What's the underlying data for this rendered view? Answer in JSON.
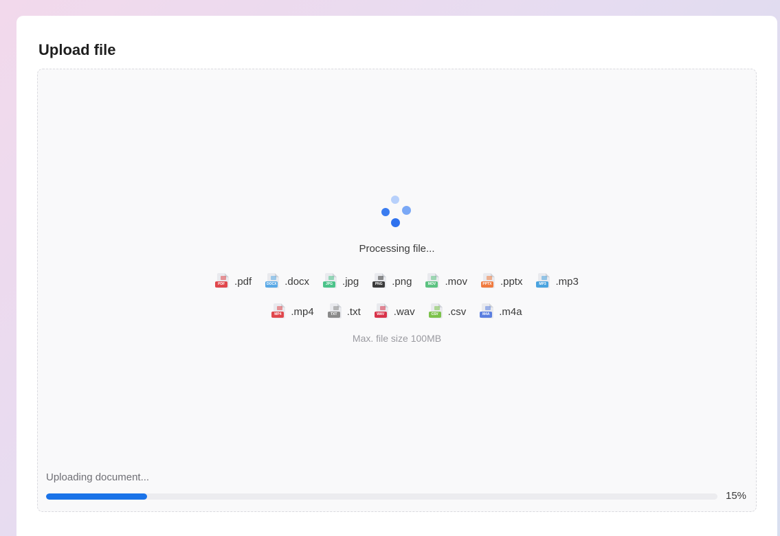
{
  "card": {
    "title": "Upload file"
  },
  "dropzone": {
    "status_text": "Processing file...",
    "max_size_text": "Max. file size 100MB",
    "file_types_row1": [
      {
        "ext": ".pdf",
        "icon": "pdf-file-icon",
        "color": "#e0474c",
        "tag": "PDF"
      },
      {
        "ext": ".docx",
        "icon": "docx-file-icon",
        "color": "#5aa9e6",
        "tag": "DOCX"
      },
      {
        "ext": ".jpg",
        "icon": "jpg-file-icon",
        "color": "#4cc38a",
        "tag": "JPG"
      },
      {
        "ext": ".png",
        "icon": "png-file-icon",
        "color": "#3b3b3b",
        "tag": "PNG"
      },
      {
        "ext": ".mov",
        "icon": "mov-file-icon",
        "color": "#5cc281",
        "tag": "MOV"
      },
      {
        "ext": ".pptx",
        "icon": "pptx-file-icon",
        "color": "#f07b3f",
        "tag": "PPTX"
      },
      {
        "ext": ".mp3",
        "icon": "mp3-file-icon",
        "color": "#4aa3df",
        "tag": "MP3"
      }
    ],
    "file_types_row2": [
      {
        "ext": ".mp4",
        "icon": "mp4-file-icon",
        "color": "#e0474c",
        "tag": "MP4"
      },
      {
        "ext": ".txt",
        "icon": "txt-file-icon",
        "color": "#8a8a8a",
        "tag": "TXT"
      },
      {
        "ext": ".wav",
        "icon": "wav-file-icon",
        "color": "#d8334a",
        "tag": "WAV"
      },
      {
        "ext": ".csv",
        "icon": "csv-file-icon",
        "color": "#7cc24c",
        "tag": "CSV"
      },
      {
        "ext": ".m4a",
        "icon": "m4a-file-icon",
        "color": "#5b7fe0",
        "tag": "M4A"
      }
    ]
  },
  "upload": {
    "label": "Uploading document...",
    "progress": 0.15,
    "progress_text": "15%",
    "accent": "#1a73e8"
  }
}
